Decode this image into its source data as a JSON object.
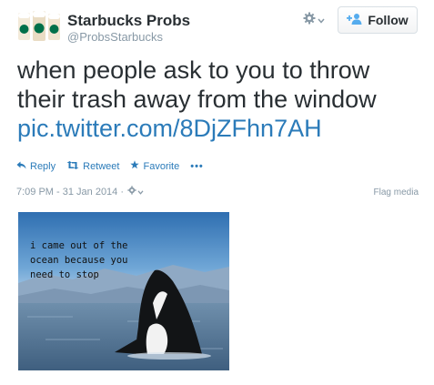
{
  "account": {
    "display_name": "Starbucks Probs",
    "handle": "@ProbsStarbucks",
    "avatar_icon": "starbucks-cups-avatar"
  },
  "follow_button": {
    "label": "Follow",
    "icon": "add-user-icon"
  },
  "tweet": {
    "text_lines": [
      "when people ask to you to throw",
      "their trash away from the window"
    ],
    "link": "pic.twitter.com/8DjZFhn7AH"
  },
  "actions": {
    "reply": "Reply",
    "retweet": "Retweet",
    "favorite": "Favorite",
    "more": "•••"
  },
  "meta": {
    "timestamp": "7:09 PM - 31 Jan 2014 ·",
    "flag_media": "Flag media"
  },
  "media": {
    "caption_lines": [
      "i came out of the",
      "ocean because you",
      "need to stop"
    ]
  },
  "colors": {
    "link": "#2b7bb9",
    "text": "#292f33",
    "muted": "#8899a6"
  }
}
